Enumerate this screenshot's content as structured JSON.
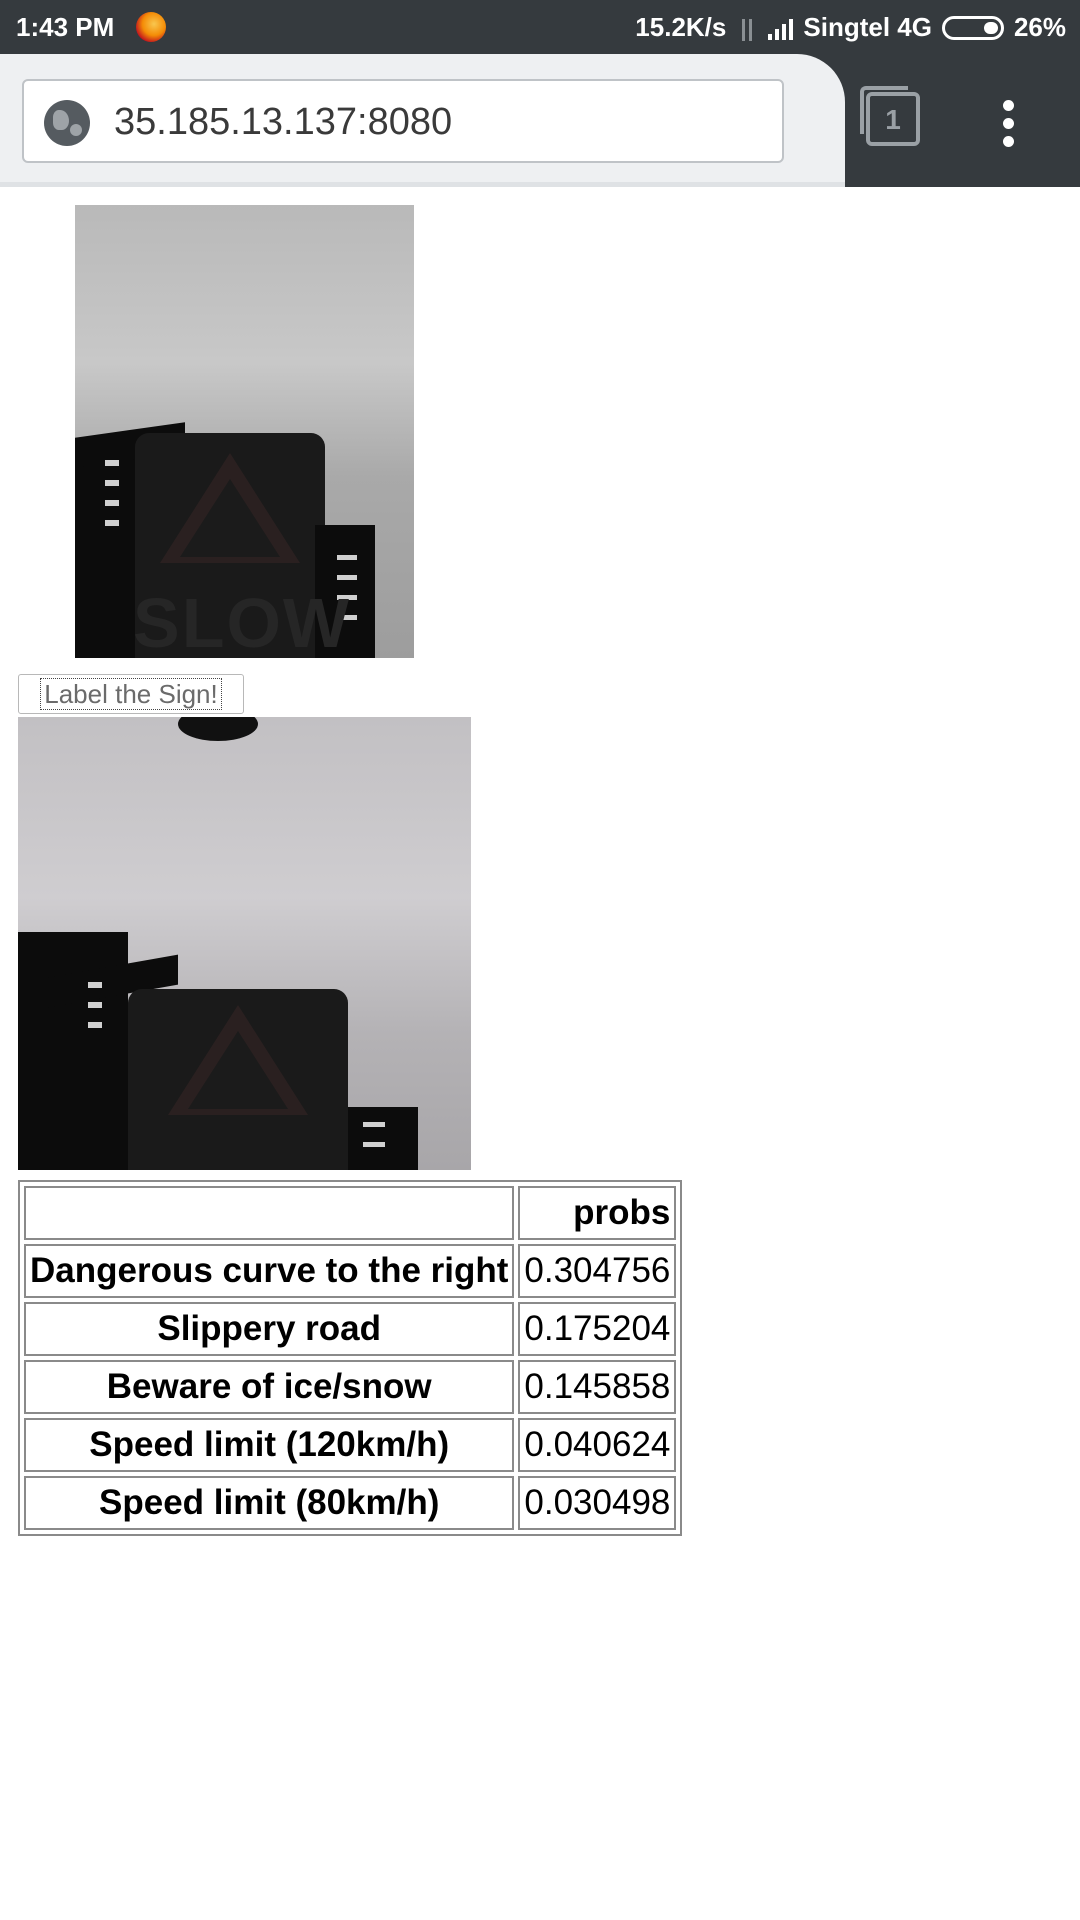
{
  "status_bar": {
    "time": "1:43 PM",
    "net_speed": "15.2K/s",
    "carrier": "Singtel 4G",
    "battery": "26%",
    "icons": [
      "firefox-icon",
      "data-transfer-icon",
      "signal-icon",
      "battery-icon"
    ]
  },
  "browser": {
    "url": "35.185.13.137:8080",
    "tab_count": "1",
    "icons": [
      "globe-icon",
      "tabs-icon",
      "overflow-menu-icon"
    ]
  },
  "page": {
    "label_button": "Label the Sign!",
    "results_table": {
      "header": [
        "",
        "probs"
      ],
      "rows": [
        {
          "label": "Dangerous curve to the right",
          "prob": "0.304756"
        },
        {
          "label": "Slippery road",
          "prob": "0.175204"
        },
        {
          "label": "Beware of ice/snow",
          "prob": "0.145858"
        },
        {
          "label": "Speed limit (120km/h)",
          "prob": "0.040624"
        },
        {
          "label": "Speed limit (80km/h)",
          "prob": "0.030498"
        }
      ]
    }
  },
  "photo_text": "SLOW"
}
